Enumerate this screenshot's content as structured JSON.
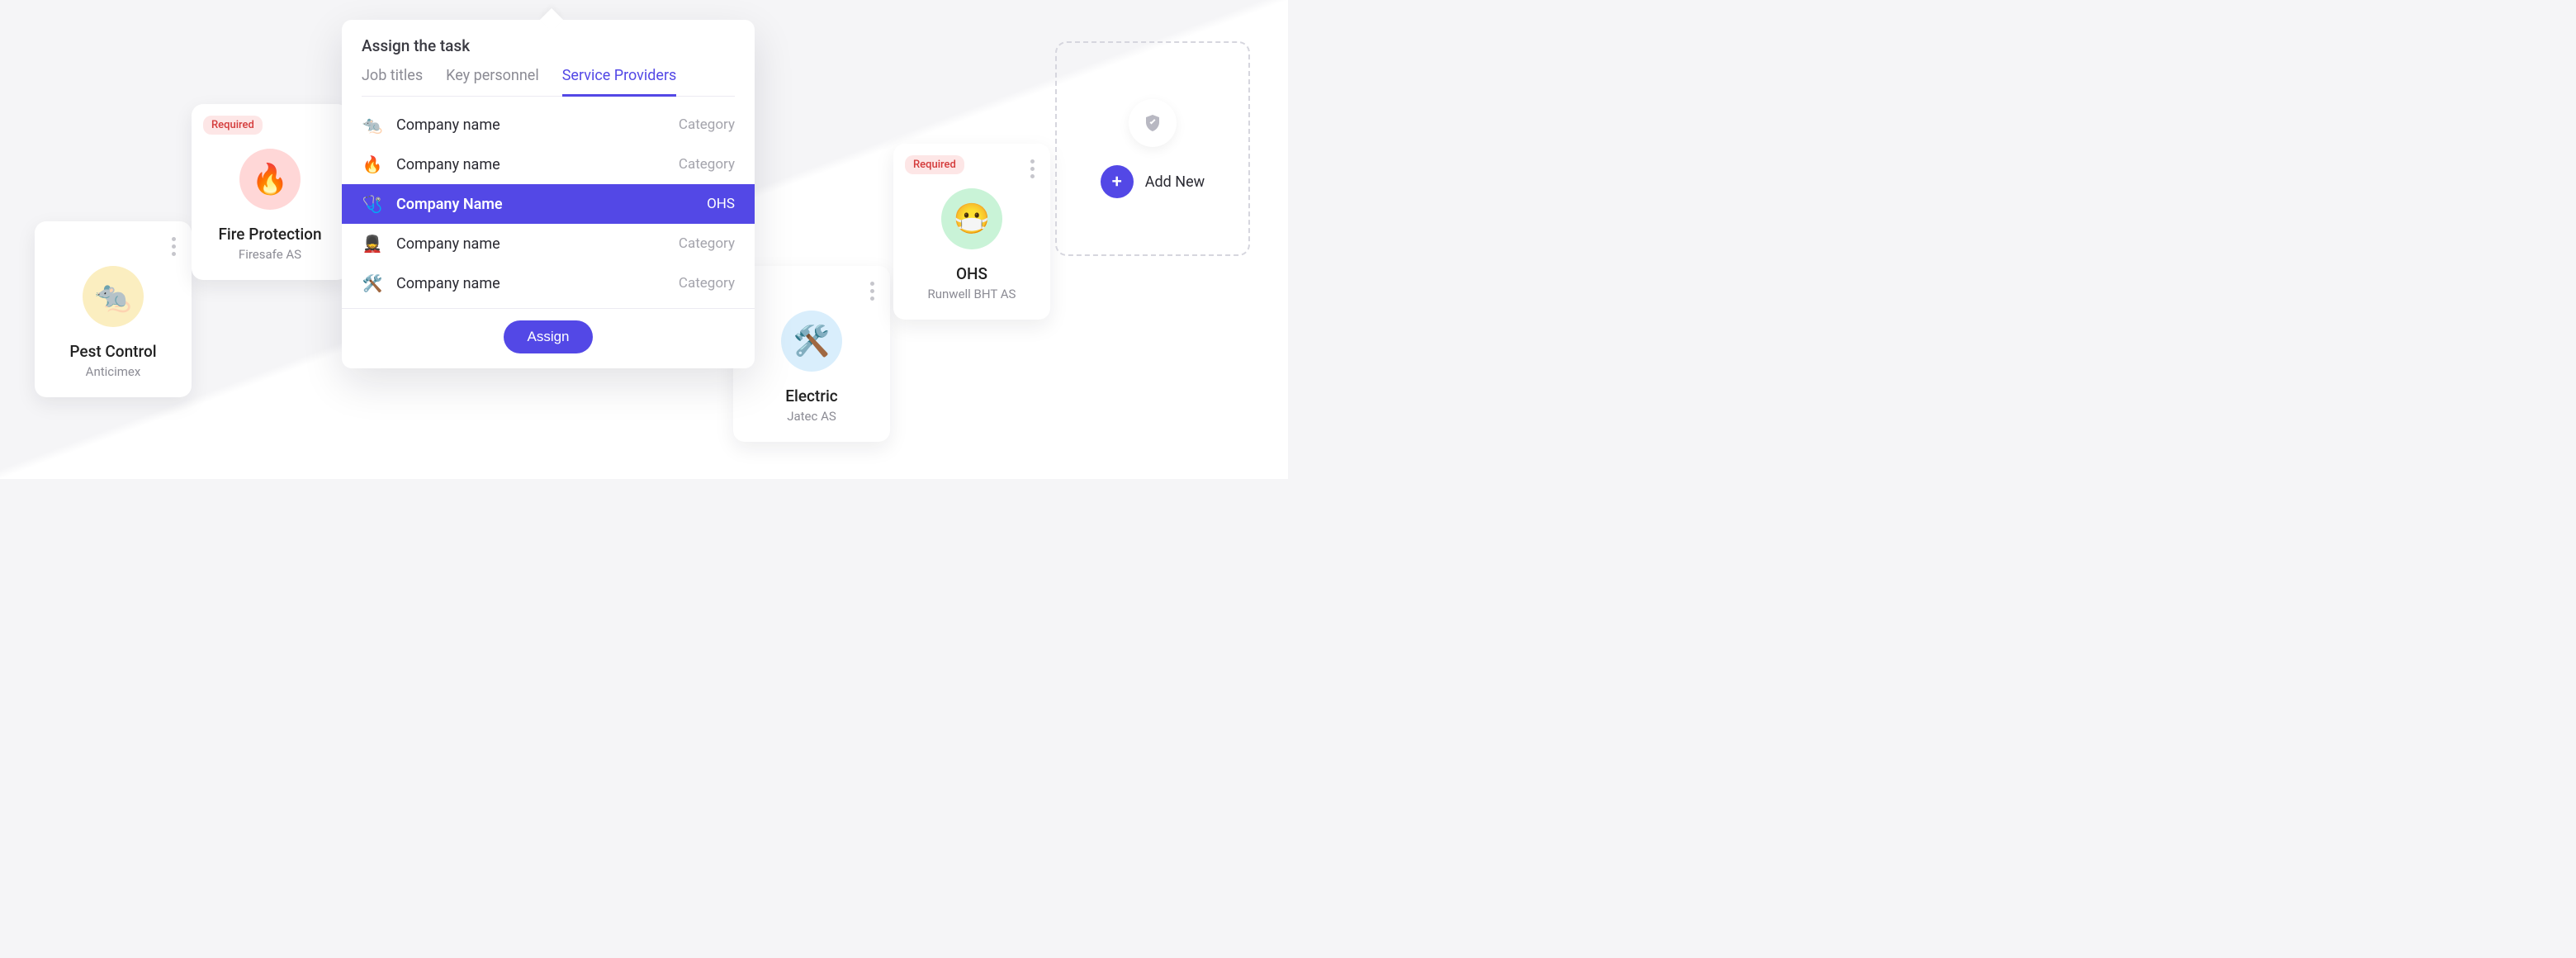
{
  "labels": {
    "required_badge": "Required",
    "add_new": "Add New"
  },
  "cards": {
    "pest": {
      "title": "Pest Control",
      "subtitle": "Anticimex",
      "emoji": "🐀"
    },
    "fire": {
      "title": "Fire Protection",
      "subtitle": "Firesafe AS",
      "emoji": "🔥"
    },
    "electric": {
      "title": "Electric",
      "subtitle": "Jatec AS",
      "emoji": "🛠️"
    },
    "ohs": {
      "title": "OHS",
      "subtitle": "Runwell BHT AS",
      "emoji": "😷"
    }
  },
  "popover": {
    "title": "Assign the task",
    "tabs": {
      "job_titles": "Job titles",
      "key_personnel": "Key personnel",
      "service_prov": "Service Providers"
    },
    "providers": [
      {
        "icon": "🐀",
        "name": "Company name",
        "category": "Category"
      },
      {
        "icon": "🔥",
        "name": "Company name",
        "category": "Category"
      },
      {
        "icon": "🩺",
        "name": "Company Name",
        "category": "OHS"
      },
      {
        "icon": "💂",
        "name": "Company name",
        "category": "Category"
      },
      {
        "icon": "🛠️",
        "name": "Company name",
        "category": "Category"
      }
    ],
    "assign_label": "Assign"
  }
}
